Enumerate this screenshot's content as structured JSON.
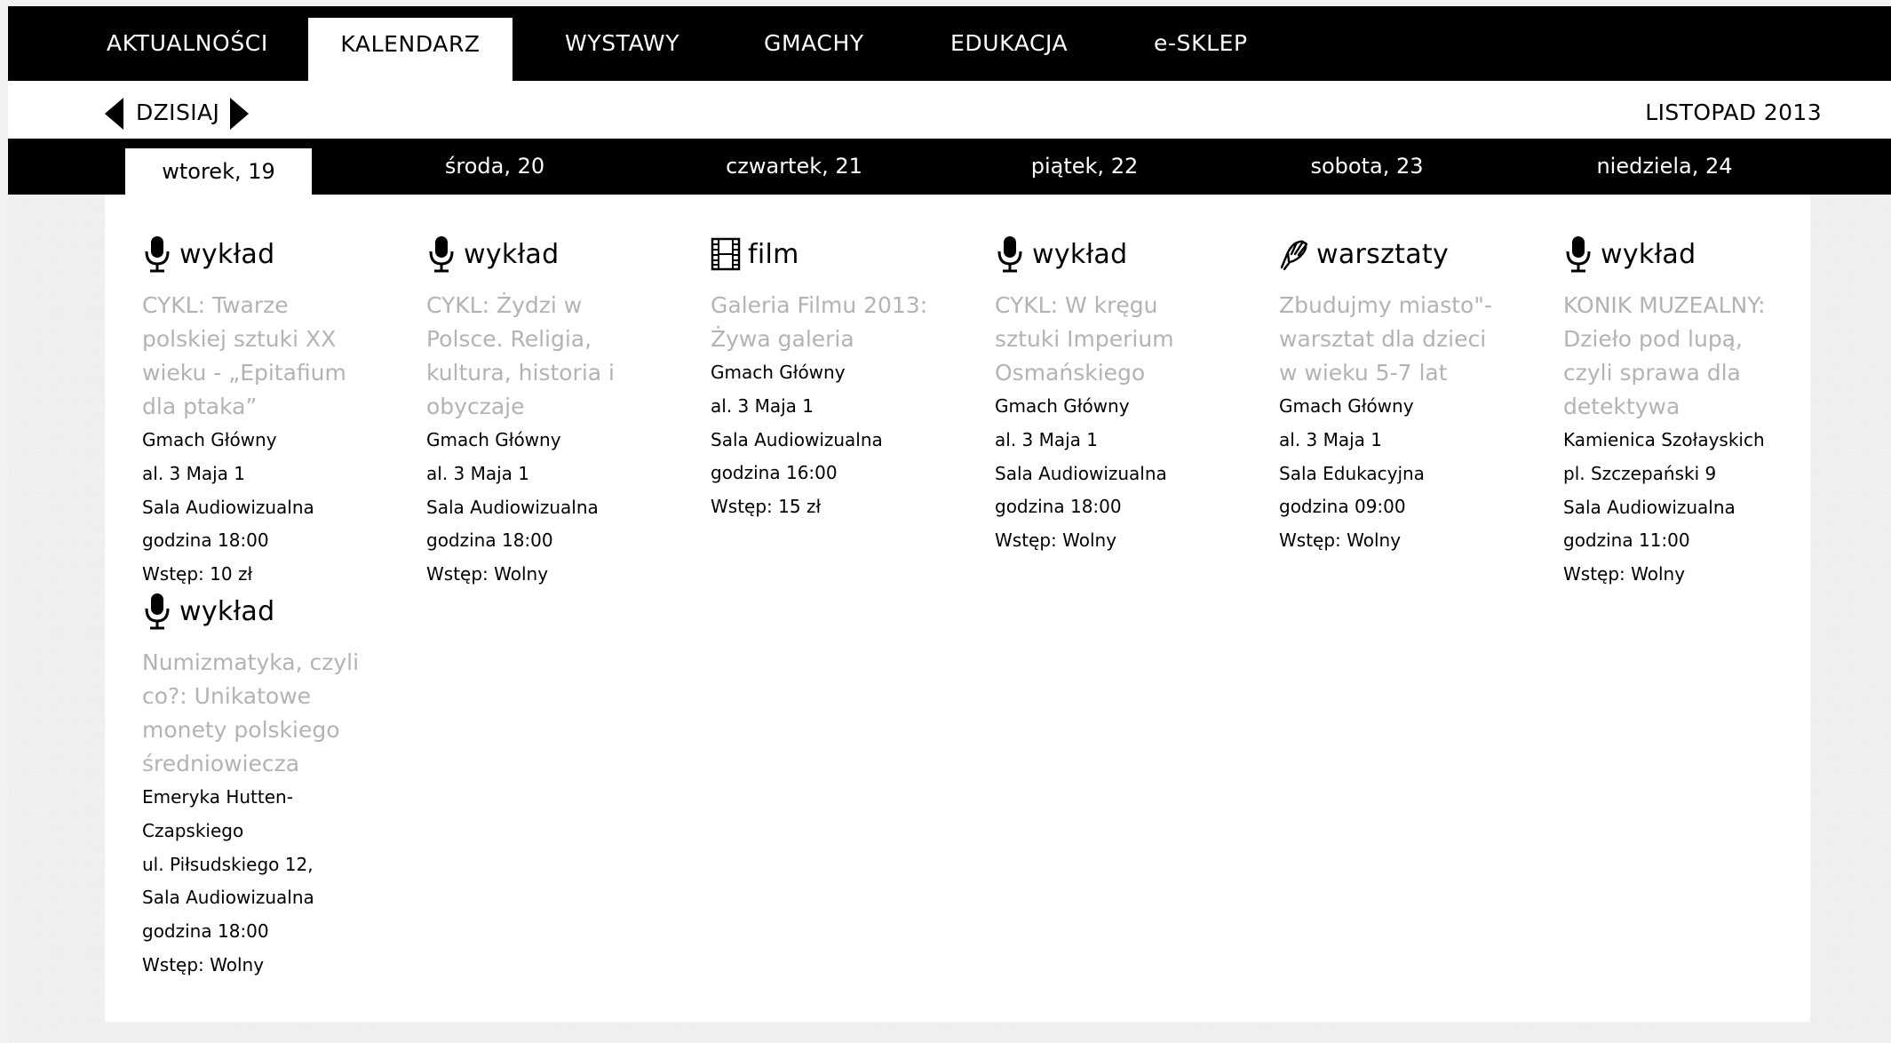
{
  "nav": {
    "items": [
      {
        "label": "AKTUALNOŚCI",
        "name": "nav-item-aktualnosci"
      },
      {
        "label": "KALENDARZ",
        "name": "nav-item-kalendarz"
      },
      {
        "label": "WYSTAWY",
        "name": "nav-item-wystawy"
      },
      {
        "label": "GMACHY",
        "name": "nav-item-gmachy"
      },
      {
        "label": "EDUKACJA",
        "name": "nav-item-edukacja"
      },
      {
        "label": "e-SKLEP",
        "name": "nav-item-e-sklep"
      }
    ],
    "active": "KALENDARZ"
  },
  "datebar": {
    "today_label": "DZISIAJ",
    "month_label": "LISTOPAD 2013"
  },
  "days": [
    {
      "label": "wtorek, 19",
      "active": true
    },
    {
      "label": "środa, 20",
      "active": false
    },
    {
      "label": "czwartek, 21",
      "active": false
    },
    {
      "label": "piątek, 22",
      "active": false
    },
    {
      "label": "sobota, 23",
      "active": false
    },
    {
      "label": "niedziela, 24",
      "active": false
    }
  ],
  "events": [
    {
      "type": "wykład",
      "icon": "microphone-icon",
      "title": "CYKL: Twarze polskiej sztuki XX wieku - „Epitafium dla ptaka”",
      "details": [
        "Gmach Główny",
        "al. 3 Maja 1",
        "Sala Audiowizualna",
        "godzina 18:00",
        "Wstęp: 10 zł"
      ]
    },
    {
      "type": "wykład",
      "icon": "microphone-icon",
      "title": "Numizmatyka, czyli co?: Unikatowe monety polskiego średniowiecza",
      "details": [
        "Emeryka Hutten-Czapskiego",
        "ul. Piłsudskiego 12,",
        "Sala Audiowizualna",
        "godzina 18:00",
        "Wstęp: Wolny"
      ]
    },
    {
      "type": "wykład",
      "icon": "microphone-icon",
      "title": "CYKL: Żydzi w Polsce. Religia, kultura, historia i obyczaje",
      "details": [
        "Gmach Główny",
        "al. 3 Maja 1",
        "Sala Audiowizualna",
        "godzina 18:00",
        "Wstęp: Wolny"
      ]
    },
    {
      "type": "film",
      "icon": "film-strip-icon",
      "title": "Galeria Filmu 2013: Żywa galeria",
      "details": [
        "Gmach Główny",
        "al. 3 Maja 1",
        "Sala Audiowizualna",
        "godzina 16:00",
        "Wstęp: 15 zł"
      ]
    },
    {
      "type": "wykład",
      "icon": "microphone-icon",
      "title": "CYKL: W kręgu sztuki Imperium Osmańskiego",
      "details": [
        "Gmach Główny",
        "al. 3 Maja 1",
        "Sala Audiowizualna",
        "godzina 18:00",
        "Wstęp: Wolny"
      ]
    },
    {
      "type": "warsztaty",
      "icon": "hand-icon",
      "title": "Zbudujmy miasto\"- warsztat dla dzieci w wieku 5-7 lat",
      "details": [
        "Gmach Główny",
        "al. 3 Maja 1",
        "Sala Edukacyjna",
        "godzina 09:00",
        "Wstęp: Wolny"
      ]
    },
    {
      "type": "wykład",
      "icon": "microphone-icon",
      "title": "KONIK MUZEALNY: Dzieło pod lupą, czyli sprawa dla detektywa",
      "details": [
        "Kamienica Szołayskich",
        "pl. Szczepański 9",
        "Sala Audiowizualna",
        "godzina 11:00",
        "Wstęp: Wolny"
      ]
    }
  ]
}
